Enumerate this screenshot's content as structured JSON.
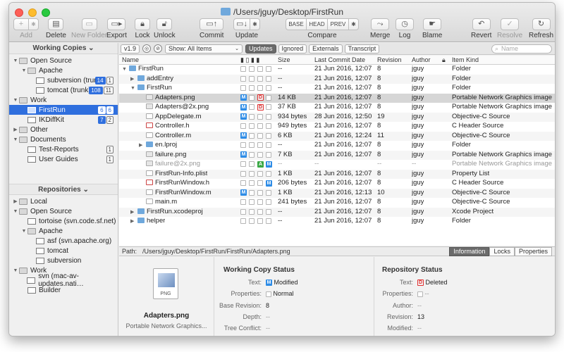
{
  "window": {
    "title": "/Users/jguy/Desktop/FirstRun"
  },
  "toolbar": {
    "add": "Add",
    "delete": "Delete",
    "new_folder": "New Folder",
    "export": "Export",
    "lock": "Lock",
    "unlock": "Unlock",
    "commit": "Commit",
    "update": "Update",
    "compare": "Compare",
    "compare_base": "BASE",
    "compare_head": "HEAD",
    "compare_prev": "PREV",
    "merge": "Merge",
    "log": "Log",
    "blame": "Blame",
    "revert": "Revert",
    "resolve": "Resolve",
    "refresh": "Refresh"
  },
  "sidebar": {
    "working_copies_header": "Working Copies ⌄",
    "repositories_header": "Repositories ⌄",
    "working_copies": [
      {
        "label": "Open Source",
        "level": 0,
        "tri": "▼",
        "icon": "folder"
      },
      {
        "label": "Apache",
        "level": 1,
        "tri": "▼",
        "icon": "folder"
      },
      {
        "label": "subversion (trunk)",
        "level": 2,
        "tri": "",
        "icon": "wc",
        "badges": [
          "14",
          "1"
        ],
        "blue": [
          0
        ]
      },
      {
        "label": "tomcat (trunk)",
        "level": 2,
        "tri": "",
        "icon": "wc",
        "badges": [
          "108",
          "11"
        ],
        "blue": [
          0
        ]
      },
      {
        "label": "Work",
        "level": 0,
        "tri": "▼",
        "icon": "folder"
      },
      {
        "label": "FirstRun",
        "level": 1,
        "tri": "",
        "icon": "wc",
        "badges": [
          "6",
          "6"
        ],
        "blue": [
          0
        ],
        "selected": true
      },
      {
        "label": "IKDiffKit",
        "level": 1,
        "tri": "",
        "icon": "wc",
        "badges": [
          "7",
          "2"
        ],
        "blue": [
          0
        ]
      },
      {
        "label": "Other",
        "level": 0,
        "tri": "▶",
        "icon": "folder"
      },
      {
        "label": "Documents",
        "level": 0,
        "tri": "▼",
        "icon": "folder"
      },
      {
        "label": "Test-Reports",
        "level": 1,
        "tri": "",
        "icon": "wc",
        "badges": [
          "1"
        ]
      },
      {
        "label": "User Guides",
        "level": 1,
        "tri": "",
        "icon": "wc",
        "badges": [
          "1"
        ]
      }
    ],
    "repositories": [
      {
        "label": "Local",
        "level": 0,
        "tri": "▶",
        "icon": "folder"
      },
      {
        "label": "Open Source",
        "level": 0,
        "tri": "▼",
        "icon": "folder"
      },
      {
        "label": "tortoise (svn.code.sf.net)",
        "level": 1,
        "tri": "",
        "icon": "wc"
      },
      {
        "label": "Apache",
        "level": 1,
        "tri": "▼",
        "icon": "folder"
      },
      {
        "label": "asf (svn.apache.org)",
        "level": 2,
        "tri": "",
        "icon": "wc"
      },
      {
        "label": "tomcat",
        "level": 2,
        "tri": "",
        "icon": "wc"
      },
      {
        "label": "subversion",
        "level": 2,
        "tri": "",
        "icon": "wc"
      },
      {
        "label": "Work",
        "level": 0,
        "tri": "▼",
        "icon": "folder"
      },
      {
        "label": "svn (mac-av-updates.nati…",
        "level": 1,
        "tri": "",
        "icon": "wc"
      },
      {
        "label": "Builder",
        "level": 1,
        "tri": "",
        "icon": "wc"
      }
    ]
  },
  "filter_bar": {
    "version": "v1.9",
    "show": "Show: All Items",
    "tabs": [
      "Updates",
      "Ignored",
      "Externals",
      "Transcript"
    ],
    "active_tab": 0,
    "search_placeholder": "Name"
  },
  "columns": {
    "name": "Name",
    "size": "Size",
    "last_commit_date": "Last Commit Date",
    "revision": "Revision",
    "author": "Author",
    "item_kind": "Item Kind"
  },
  "files": [
    {
      "name": "FirstRun",
      "indent": 0,
      "tri": "▼",
      "icon": "folder",
      "status": [],
      "size": "--",
      "date": "21 Jun 2016, 12:07",
      "rev": "8",
      "author": "jguy",
      "kind": "Folder"
    },
    {
      "name": "addEntry",
      "indent": 1,
      "tri": "▶",
      "icon": "folder",
      "status": [],
      "size": "--",
      "date": "21 Jun 2016, 12:07",
      "rev": "8",
      "author": "jguy",
      "kind": "Folder"
    },
    {
      "name": "FirstRun",
      "indent": 1,
      "tri": "▼",
      "icon": "folder",
      "status": [],
      "size": "--",
      "date": "21 Jun 2016, 12:07",
      "rev": "8",
      "author": "jguy",
      "kind": "Folder"
    },
    {
      "name": "Adapters.png",
      "indent": 2,
      "tri": "",
      "icon": "img",
      "status": [
        "M",
        "",
        "D",
        ""
      ],
      "size": "14 KB",
      "date": "21 Jun 2016, 12:07",
      "rev": "8",
      "author": "jguy",
      "kind": "Portable Network Graphics image",
      "selected": true
    },
    {
      "name": "Adapters@2x.png",
      "indent": 2,
      "tri": "",
      "icon": "img",
      "status": [
        "M",
        "",
        "D",
        ""
      ],
      "size": "37 KB",
      "date": "21 Jun 2016, 12:07",
      "rev": "8",
      "author": "jguy",
      "kind": "Portable Network Graphics image"
    },
    {
      "name": "AppDelegate.m",
      "indent": 2,
      "tri": "",
      "icon": "m",
      "status": [
        "M",
        "",
        "",
        ""
      ],
      "size": "934 bytes",
      "date": "28 Jun 2016, 12:50",
      "rev": "19",
      "author": "jguy",
      "kind": "Objective-C Source"
    },
    {
      "name": "Controller.h",
      "indent": 2,
      "tri": "",
      "icon": "h",
      "status": [],
      "size": "949 bytes",
      "date": "21 Jun 2016, 12:07",
      "rev": "8",
      "author": "jguy",
      "kind": "C Header Source"
    },
    {
      "name": "Controller.m",
      "indent": 2,
      "tri": "",
      "icon": "m",
      "status": [
        "M",
        "",
        "",
        ""
      ],
      "size": "6 KB",
      "date": "21 Jun 2016, 12:24",
      "rev": "11",
      "author": "jguy",
      "kind": "Objective-C Source"
    },
    {
      "name": "en.lproj",
      "indent": 2,
      "tri": "▶",
      "icon": "folder",
      "status": [],
      "size": "--",
      "date": "21 Jun 2016, 12:07",
      "rev": "8",
      "author": "jguy",
      "kind": "Folder"
    },
    {
      "name": "failure.png",
      "indent": 2,
      "tri": "",
      "icon": "img",
      "status": [
        "M",
        "",
        "",
        ""
      ],
      "size": "7 KB",
      "date": "21 Jun 2016, 12:07",
      "rev": "8",
      "author": "jguy",
      "kind": "Portable Network Graphics image"
    },
    {
      "name": "failure@2x.png",
      "indent": 2,
      "tri": "",
      "icon": "img",
      "status": [
        "",
        "",
        "A",
        "M"
      ],
      "size": "--",
      "date": "--",
      "rev": "--",
      "author": "--",
      "kind": "Portable Network Graphics image",
      "dim": true
    },
    {
      "name": "FirstRun-Info.plist",
      "indent": 2,
      "tri": "",
      "icon": "m",
      "status": [],
      "size": "1 KB",
      "date": "21 Jun 2016, 12:07",
      "rev": "8",
      "author": "jguy",
      "kind": "Property List"
    },
    {
      "name": "FirstRunWindow.h",
      "indent": 2,
      "tri": "",
      "icon": "h",
      "status": [
        "",
        "",
        "",
        "M"
      ],
      "size": "206 bytes",
      "date": "21 Jun 2016, 12:07",
      "rev": "8",
      "author": "jguy",
      "kind": "C Header Source"
    },
    {
      "name": "FirstRunWindow.m",
      "indent": 2,
      "tri": "",
      "icon": "m",
      "status": [
        "M",
        "",
        "",
        ""
      ],
      "size": "1 KB",
      "date": "21 Jun 2016, 12:13",
      "rev": "10",
      "author": "jguy",
      "kind": "Objective-C Source"
    },
    {
      "name": "main.m",
      "indent": 2,
      "tri": "",
      "icon": "m",
      "status": [],
      "size": "241 bytes",
      "date": "21 Jun 2016, 12:07",
      "rev": "8",
      "author": "jguy",
      "kind": "Objective-C Source"
    },
    {
      "name": "FirstRun.xcodeproj",
      "indent": 1,
      "tri": "▶",
      "icon": "folder",
      "status": [],
      "size": "--",
      "date": "21 Jun 2016, 12:07",
      "rev": "8",
      "author": "jguy",
      "kind": "Xcode Project"
    },
    {
      "name": "helper",
      "indent": 1,
      "tri": "▶",
      "icon": "folder",
      "status": [],
      "size": "--",
      "date": "21 Jun 2016, 12:07",
      "rev": "8",
      "author": "jguy",
      "kind": "Folder"
    }
  ],
  "pathbar": {
    "label": "Path:",
    "path": "/Users/jguy/Desktop/FirstRun/FirstRun/Adapters.png",
    "tabs": [
      "Information",
      "Locks",
      "Properties"
    ],
    "active_tab": 0
  },
  "preview": {
    "filename": "Adapters.png",
    "kind": "Portable Network Graphics...",
    "ext": "PNG"
  },
  "working_copy_status": {
    "title": "Working Copy Status",
    "text_label": "Text:",
    "text_value": "Modified",
    "text_badge": "M",
    "properties_label": "Properties:",
    "properties_value": "Normal",
    "base_revision_label": "Base Revision:",
    "base_revision_value": "8",
    "depth_label": "Depth:",
    "depth_value": "--",
    "tree_conflict_label": "Tree Conflict:",
    "tree_conflict_value": "--"
  },
  "repository_status": {
    "title": "Repository Status",
    "text_label": "Text:",
    "text_value": "Deleted",
    "text_badge": "D",
    "properties_label": "Properties:",
    "properties_value": "--",
    "author_label": "Author:",
    "author_value": "--",
    "revision_label": "Revision:",
    "revision_value": "13",
    "modified_label": "Modified:",
    "modified_value": "--"
  }
}
